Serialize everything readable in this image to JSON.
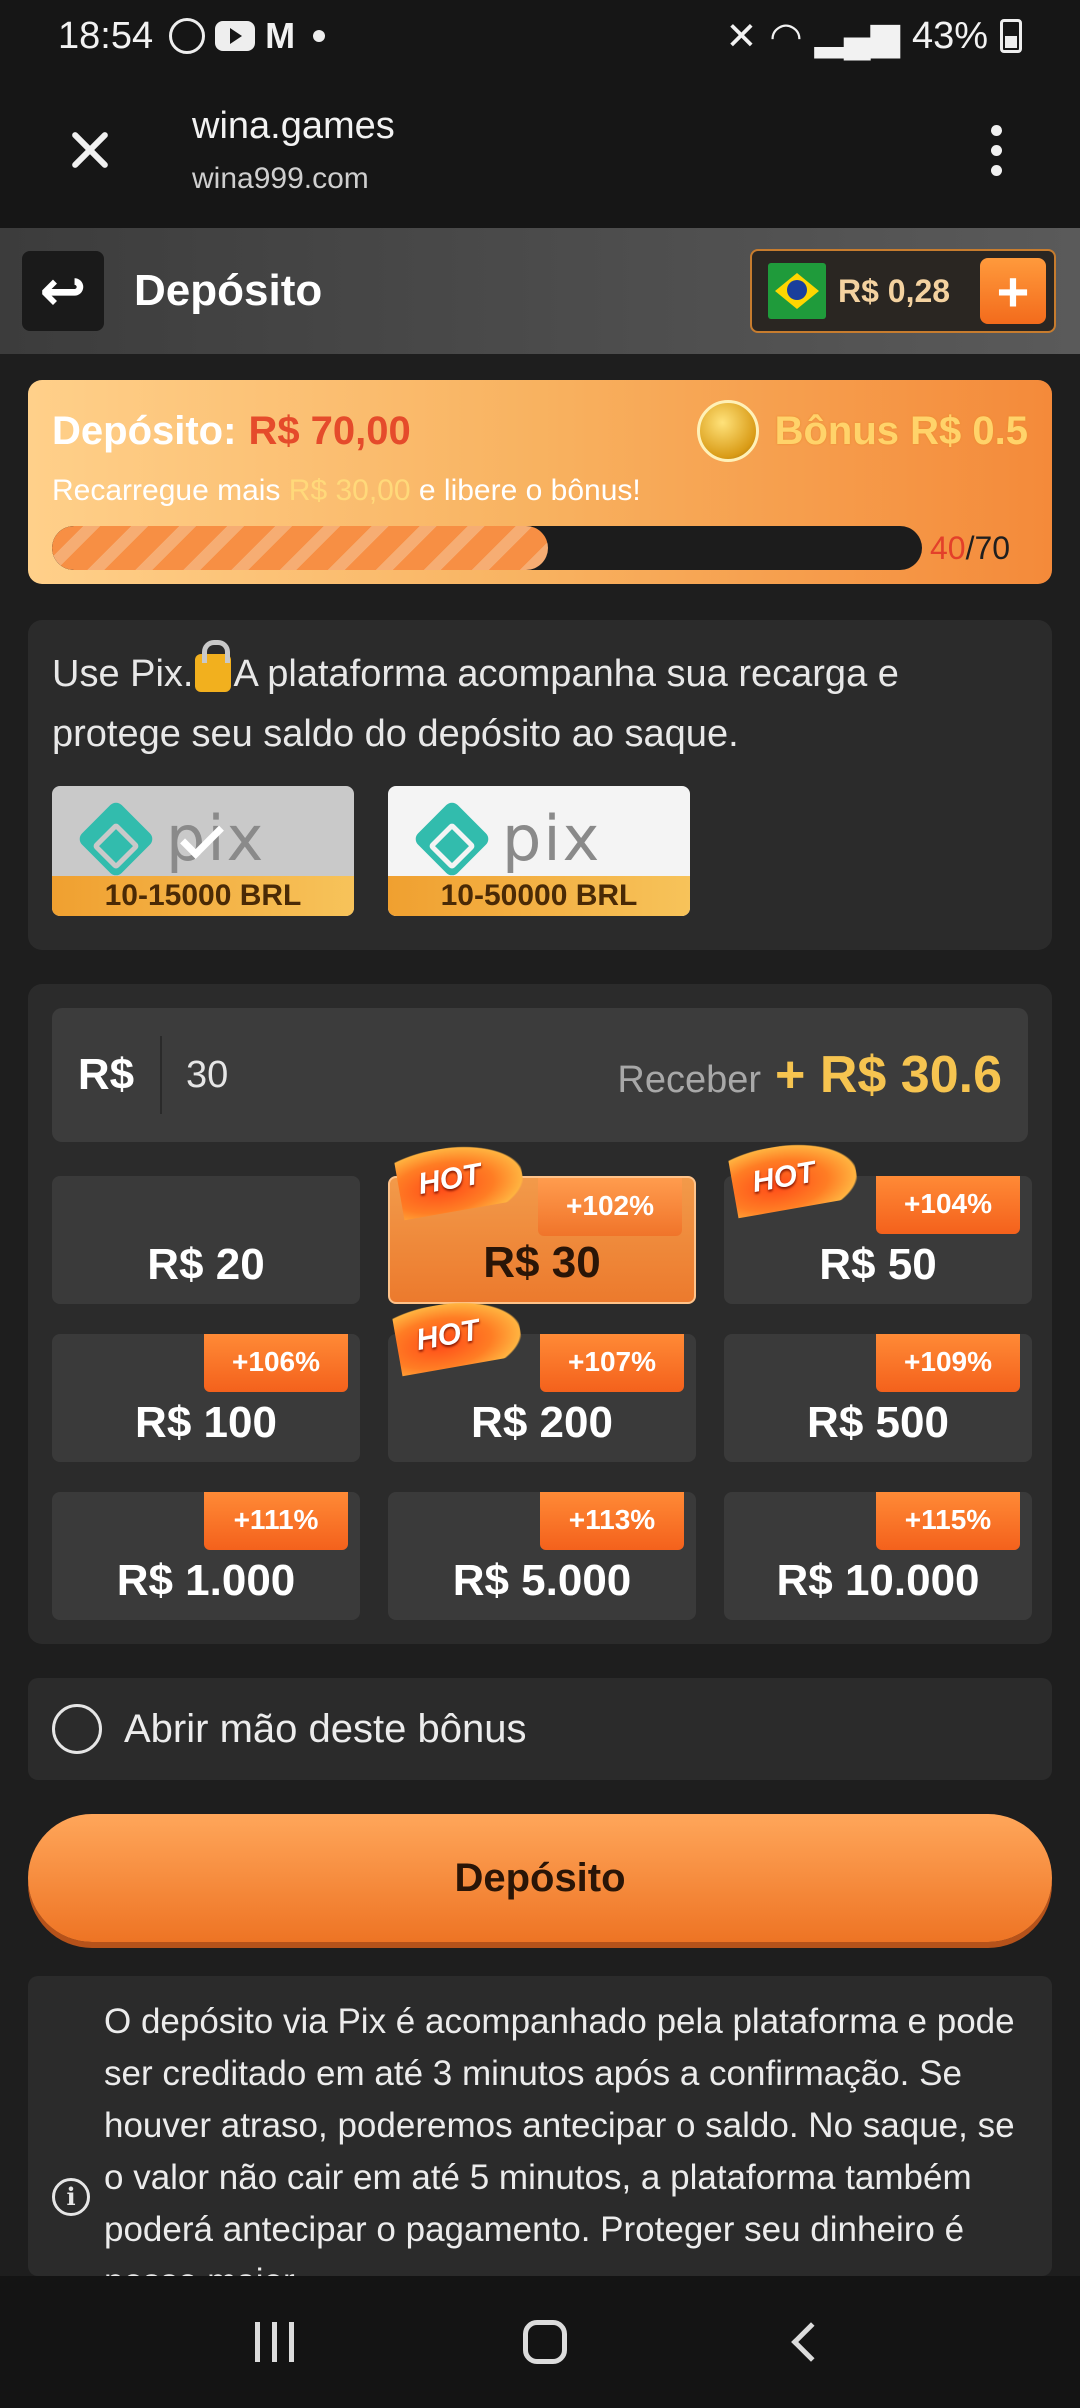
{
  "statusbar": {
    "time": "18:54",
    "notification_icons": [
      "whatsapp-icon",
      "youtube-icon",
      "gmail-icon"
    ],
    "battery": "43%"
  },
  "browser": {
    "title": "wina.games",
    "url": "wina999.com"
  },
  "header": {
    "title": "Depósito",
    "balance": "R$ 0,28"
  },
  "bonus_card": {
    "deposit_label": "Depósito:",
    "deposit_amount": "R$ 70,00",
    "bonus_label": "Bônus R$ 0.5",
    "recharge_prefix": "Recarregue mais",
    "recharge_amount": "R$ 30,00",
    "recharge_suffix": "e libere o bônus!",
    "progress_current": "40",
    "progress_total": "/70",
    "progress_fraction": 0.57
  },
  "pix": {
    "description_1": "Use Pix.",
    "description_2": "A plataforma acompanha sua recarga e protege seu saldo do depósito ao saque.",
    "options": [
      {
        "logo": "pix",
        "range": "10-15000 BRL",
        "selected": true
      },
      {
        "logo": "pix",
        "range": "10-50000 BRL",
        "selected": false
      }
    ]
  },
  "amount": {
    "currency": "R$",
    "value": "30",
    "receive_label": "Receber",
    "receive_value": "+ R$ 30.6",
    "options": [
      {
        "label": "R$ 20",
        "bonus": "",
        "hot": false,
        "selected": false
      },
      {
        "label": "R$ 30",
        "bonus": "+102%",
        "hot": true,
        "selected": true
      },
      {
        "label": "R$ 50",
        "bonus": "+104%",
        "hot": true,
        "selected": false
      },
      {
        "label": "R$ 100",
        "bonus": "+106%",
        "hot": false,
        "selected": false
      },
      {
        "label": "R$ 200",
        "bonus": "+107%",
        "hot": true,
        "selected": false
      },
      {
        "label": "R$ 500",
        "bonus": "+109%",
        "hot": false,
        "selected": false
      },
      {
        "label": "R$ 1.000",
        "bonus": "+111%",
        "hot": false,
        "selected": false
      },
      {
        "label": "R$ 5.000",
        "bonus": "+113%",
        "hot": false,
        "selected": false
      },
      {
        "label": "R$ 10.000",
        "bonus": "+115%",
        "hot": false,
        "selected": false
      }
    ],
    "hot_label": "HOT"
  },
  "giveup": {
    "label": "Abrir mão deste bônus"
  },
  "deposit_button": "Depósito",
  "info": {
    "text": "O depósito via Pix é acompanhado pela plataforma e pode ser creditado em até 3 minutos após a confirmação. Se houver atraso, poderemos antecipar o saldo. No saque, se o valor não cair em até 5 minutos, a plataforma também poderá antecipar o pagamento. Proteger seu dinheiro é nosso maior"
  }
}
